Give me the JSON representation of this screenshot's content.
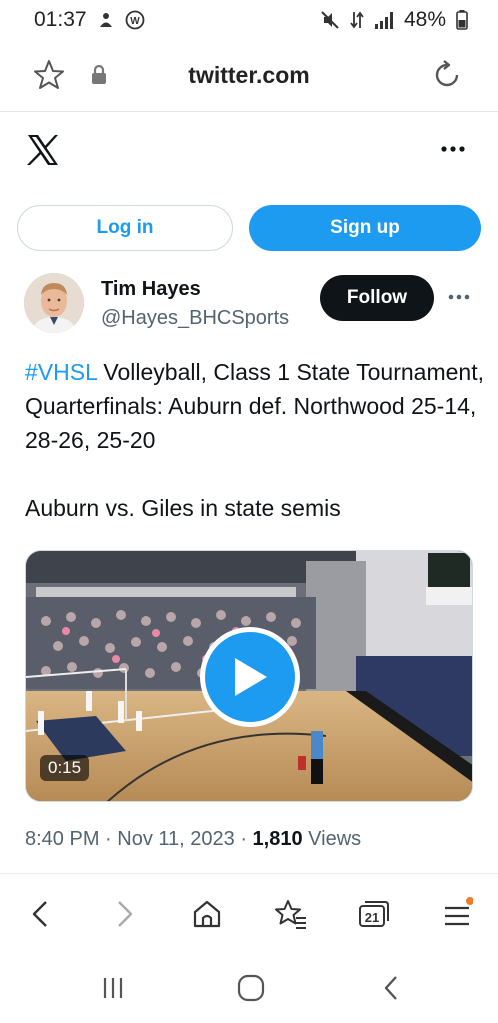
{
  "status_bar": {
    "time": "01:37",
    "battery": "48%"
  },
  "browser": {
    "url": "twitter.com"
  },
  "auth": {
    "login_label": "Log in",
    "signup_label": "Sign up"
  },
  "tweet": {
    "author_name": "Tim Hayes",
    "author_handle": "@Hayes_BHCSports",
    "follow_label": "Follow",
    "hashtag": "#VHSL",
    "text_line1": " Volleyball, Class 1 State Tournament, Quarterfinals: Auburn def. Northwood 25-14, 28-26, 25-20",
    "text_line2": "Auburn vs. Giles in state semis",
    "video_duration": "0:15",
    "time": "8:40 PM",
    "separator": " · ",
    "date": "Nov 11, 2023",
    "views_count": "1,810",
    "views_label": " Views"
  },
  "bottom_bar": {
    "tabs_count": "21"
  },
  "colors": {
    "accent": "#1d9bf0",
    "text_primary": "#0f1419",
    "text_secondary": "#536471"
  },
  "icons": [
    "star-icon",
    "lock-icon",
    "reload-icon",
    "x-logo-icon",
    "more-icon",
    "play-icon",
    "back-icon",
    "forward-icon",
    "home-icon",
    "bookmarks-icon",
    "tabs-icon",
    "menu-icon"
  ]
}
